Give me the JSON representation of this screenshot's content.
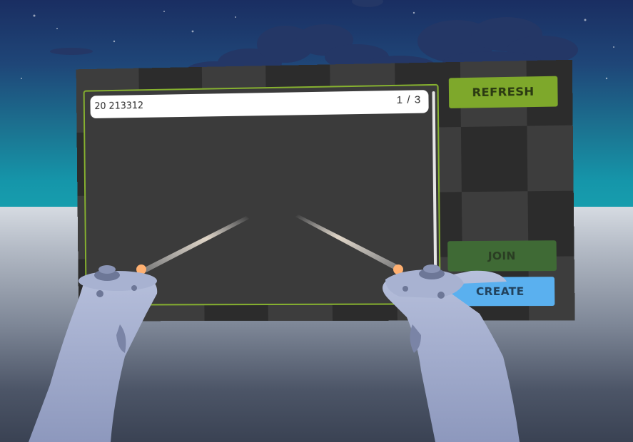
{
  "rooms_panel": {
    "room_list": [
      {
        "name": "20 213312"
      }
    ],
    "page_indicator": "1 / 3",
    "refresh_label": "REFRESH",
    "join_label": "JOIN",
    "create_label": "CREATE"
  },
  "colors": {
    "accent_green": "#86b12f",
    "join_green": "#3f6a35",
    "create_blue": "#5ab0ef",
    "panel_dark": "#3d3d3d"
  }
}
